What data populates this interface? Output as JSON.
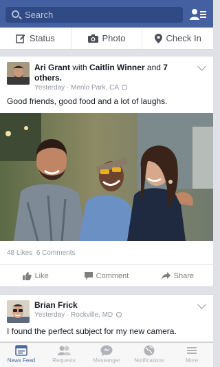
{
  "search": {
    "placeholder": "Search"
  },
  "composer": {
    "status": "Status",
    "photo": "Photo",
    "checkin": "Check In"
  },
  "post1": {
    "author": "Ari Grant",
    "with_text": " with ",
    "tagged": "Caitlin Winner",
    "and_text": " and ",
    "others": "7 others.",
    "time": "Yesterday",
    "location": "Menlo Park, CA",
    "text": "Good friends, good food and a lot of laughs.",
    "likes": "48 Likes",
    "comments": "6 Comments"
  },
  "actions": {
    "like": "Like",
    "comment": "Comment",
    "share": "Share"
  },
  "post2": {
    "author": "Brian Frick",
    "time": "Yesterday",
    "location": "Rockville, MD",
    "text": "I found the perfect subject for my new camera."
  },
  "tabs": [
    "News Feed",
    "Requests",
    "Messenger",
    "Notifications",
    "More"
  ],
  "colors": {
    "brand": "#4460a0",
    "active_tab": "#4e69a2"
  }
}
